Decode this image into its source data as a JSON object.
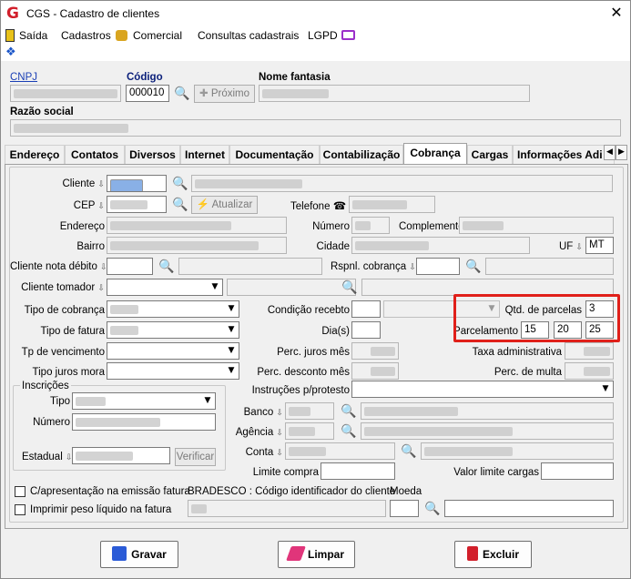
{
  "window": {
    "title": "CGS - Cadastro de clientes",
    "close_glyph": "✕"
  },
  "menu": {
    "saida": "Saída",
    "cadastros": "Cadastros",
    "comercial": "Comercial",
    "consultas": "Consultas cadastrais",
    "lgpd": "LGPD"
  },
  "header": {
    "cnpj_label": "CNPJ",
    "codigo_label": "Código",
    "codigo_value": "000010",
    "proximo_label": "Próximo",
    "nome_fantasia_label": "Nome fantasia",
    "razao_social_label": "Razão social"
  },
  "tabs": [
    "Endereço",
    "Contatos",
    "Diversos",
    "Internet",
    "Documentação",
    "Contabilização",
    "Cobrança",
    "Cargas",
    "Informações Adi"
  ],
  "form": {
    "cliente": "Cliente",
    "cep": "CEP",
    "atualizar": "Atualizar",
    "telefone": "Telefone",
    "endereco": "Endereço",
    "numero": "Número",
    "complemento": "Complemento",
    "bairro": "Bairro",
    "cidade": "Cidade",
    "uf": "UF",
    "uf_value": "MT",
    "cliente_nota_debito": "Cliente nota débito",
    "rspnl_cobranca": "Rspnl. cobrança",
    "cliente_tomador": "Cliente tomador",
    "tipo_cobranca": "Tipo de cobrança",
    "condicao_recebto": "Condição recebto",
    "qtd_parcelas": "Qtd. de parcelas",
    "qtd_parcelas_value": "3",
    "tipo_fatura": "Tipo de fatura",
    "dias": "Dia(s)",
    "parcelamento": "Parcelamento",
    "parcelamento_values": [
      "15",
      "20",
      "25"
    ],
    "tp_vencimento": "Tp de vencimento",
    "perc_juros_mes": "Perc. juros mês",
    "taxa_administrativa": "Taxa administrativa",
    "tipo_juros_mora": "Tipo juros mora",
    "perc_desconto_mes": "Perc. desconto mês",
    "perc_multa": "Perc. de multa",
    "inscricoes": "Inscrições",
    "tipo": "Tipo",
    "numero_insc": "Número",
    "estadual": "Estadual",
    "verificar": "Verificar",
    "instrucoes": "Instruções p/protesto",
    "banco": "Banco",
    "agencia": "Agência",
    "conta": "Conta",
    "limite_compra": "Limite compra",
    "valor_limite_cargas": "Valor limite cargas",
    "c_apresentacao": "C/apresentação na emissão fatura",
    "bradesco": "BRADESCO : Código identificador do cliente",
    "moeda": "Moeda",
    "imprimir_peso": "Imprimir peso líquido na fatura"
  },
  "buttons": {
    "gravar": "Gravar",
    "limpar": "Limpar",
    "excluir": "Excluir"
  },
  "colors": {
    "accent_red": "#e0201a",
    "link_blue": "#1a3fb5",
    "search_icon": "#8a3fc9"
  }
}
